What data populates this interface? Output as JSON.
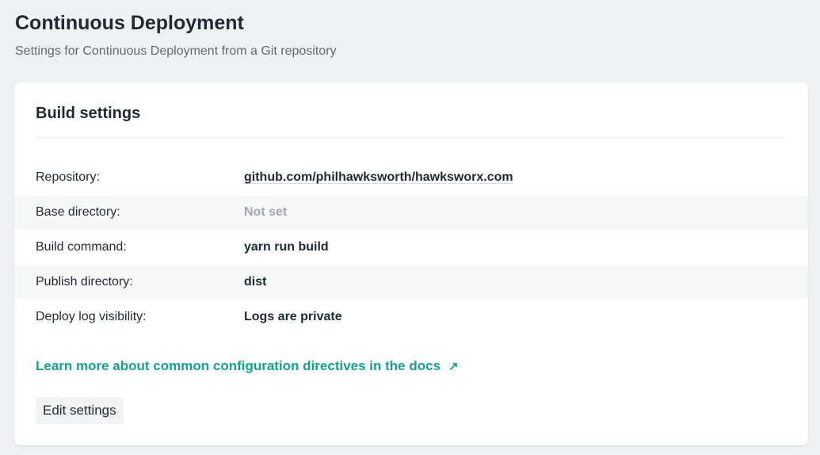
{
  "header": {
    "title": "Continuous Deployment",
    "subtitle": "Settings for Continuous Deployment from a Git repository"
  },
  "card": {
    "title": "Build settings",
    "rows": [
      {
        "label": "Repository:",
        "value": "github.com/philhawksworth/hawksworx.com"
      },
      {
        "label": "Base directory:",
        "value": "Not set"
      },
      {
        "label": "Build command:",
        "value": "yarn run build"
      },
      {
        "label": "Publish directory:",
        "value": "dist"
      },
      {
        "label": "Deploy log visibility:",
        "value": "Logs are private"
      }
    ],
    "docs_link": "Learn more about common configuration directives in the docs",
    "docs_icon": "↗",
    "edit_button": "Edit settings"
  },
  "colors": {
    "accent": "#13a38a",
    "background": "#eff2f5"
  }
}
